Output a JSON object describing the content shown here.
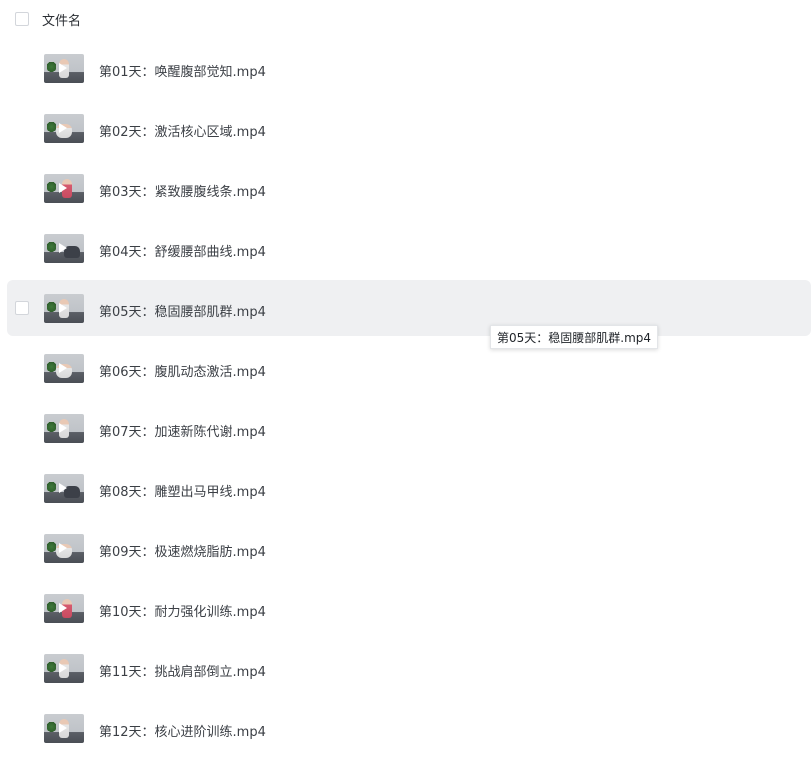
{
  "header": {
    "label": "文件名"
  },
  "files": [
    {
      "name": "第01天：唤醒腹部觉知.mp4"
    },
    {
      "name": "第02天：激活核心区域.mp4"
    },
    {
      "name": "第03天：紧致腰腹线条.mp4"
    },
    {
      "name": "第04天：舒缓腰部曲线.mp4"
    },
    {
      "name": "第05天：稳固腰部肌群.mp4"
    },
    {
      "name": "第06天：腹肌动态激活.mp4"
    },
    {
      "name": "第07天：加速新陈代谢.mp4"
    },
    {
      "name": "第08天：雕塑出马甲线.mp4"
    },
    {
      "name": "第09天：极速燃烧脂肪.mp4"
    },
    {
      "name": "第10天：耐力强化训练.mp4"
    },
    {
      "name": "第11天：挑战肩部倒立.mp4"
    },
    {
      "name": "第12天：核心进阶训练.mp4"
    }
  ],
  "tooltip": {
    "text": "第05天：稳固腰部肌群.mp4"
  },
  "colors": {
    "hover_row": "#eff0f2",
    "text": "#3b3f45",
    "checkbox_border": "#d3d6db"
  },
  "icons": {
    "thumbnail": "video-thumbnail-icon",
    "checkbox": "checkbox-icon"
  }
}
